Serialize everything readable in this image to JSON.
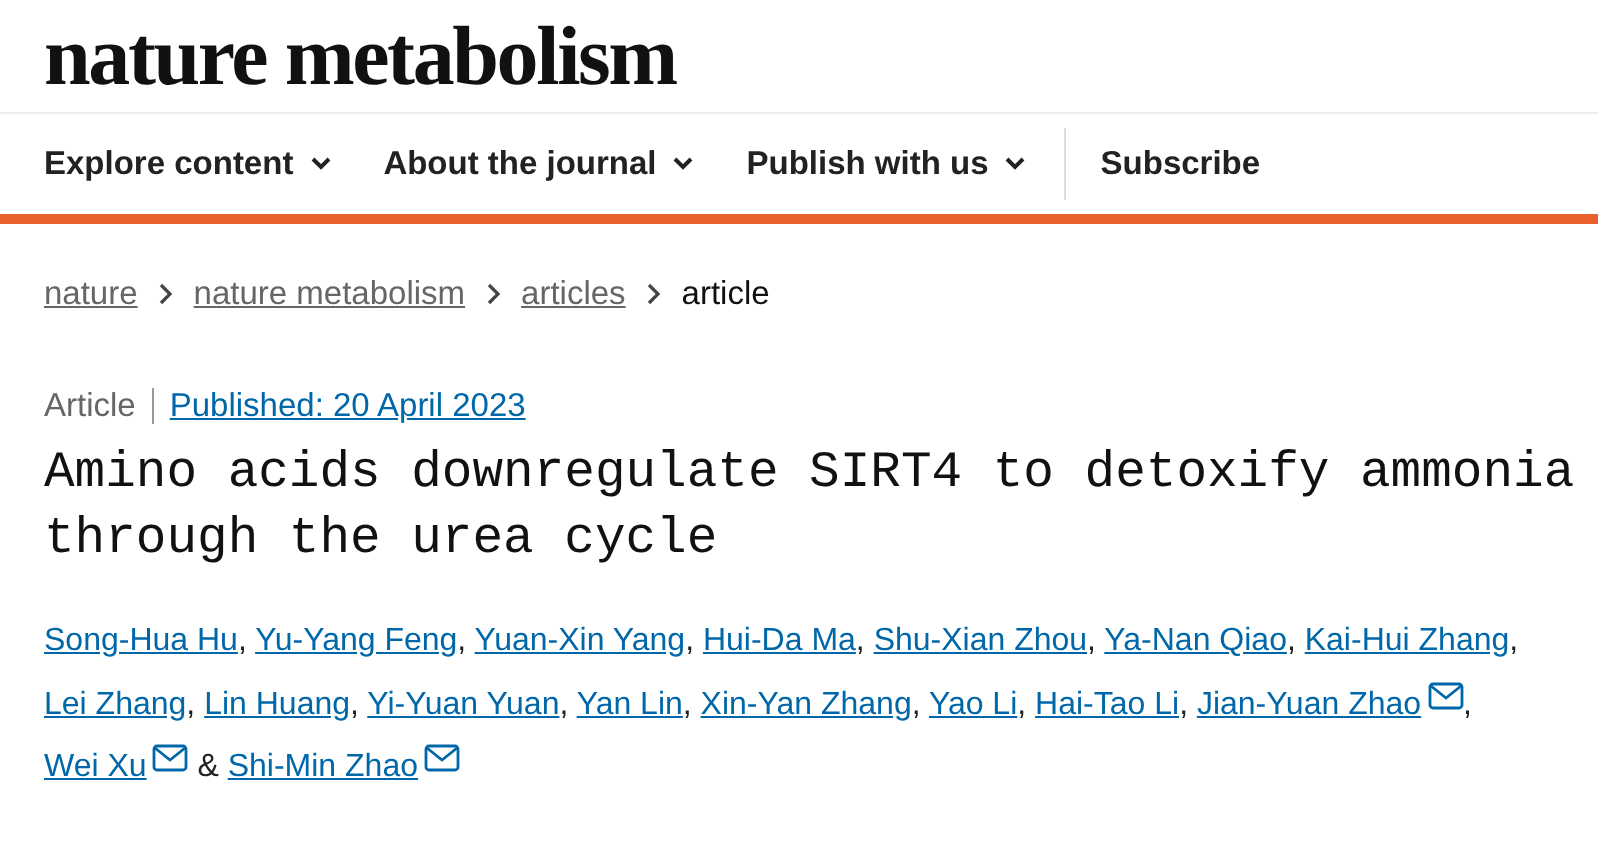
{
  "logo": "nature metabolism",
  "nav": [
    {
      "label": "Explore content",
      "dropdown": true
    },
    {
      "label": "About the journal",
      "dropdown": true
    },
    {
      "label": "Publish with us",
      "dropdown": true
    },
    {
      "label": "Subscribe",
      "dropdown": false
    }
  ],
  "breadcrumb": [
    {
      "label": "nature",
      "current": false
    },
    {
      "label": "nature metabolism",
      "current": false
    },
    {
      "label": "articles",
      "current": false
    },
    {
      "label": "article",
      "current": true
    }
  ],
  "article_type": "Article",
  "published": "Published: 20 April 2023",
  "title": "Amino acids downregulate SIRT4 to detoxify ammonia through the urea cycle",
  "authors": [
    {
      "name": "Song-Hua Hu",
      "email": false,
      "separator": ","
    },
    {
      "name": "Yu-Yang Feng",
      "email": false,
      "separator": ","
    },
    {
      "name": "Yuan-Xin Yang",
      "email": false,
      "separator": ","
    },
    {
      "name": "Hui-Da Ma",
      "email": false,
      "separator": ","
    },
    {
      "name": "Shu-Xian Zhou",
      "email": false,
      "separator": ","
    },
    {
      "name": "Ya-Nan Qiao",
      "email": false,
      "separator": ","
    },
    {
      "name": "Kai-Hui Zhang",
      "email": false,
      "separator": ","
    },
    {
      "name": "Lei Zhang",
      "email": false,
      "separator": ","
    },
    {
      "name": "Lin Huang",
      "email": false,
      "separator": ","
    },
    {
      "name": "Yi-Yuan Yuan",
      "email": false,
      "separator": ","
    },
    {
      "name": "Yan Lin",
      "email": false,
      "separator": ","
    },
    {
      "name": "Xin-Yan Zhang",
      "email": false,
      "separator": ","
    },
    {
      "name": "Yao Li",
      "email": false,
      "separator": ","
    },
    {
      "name": "Hai-Tao Li",
      "email": false,
      "separator": ","
    },
    {
      "name": "Jian-Yuan Zhao",
      "email": true,
      "separator": ","
    },
    {
      "name": "Wei Xu",
      "email": true,
      "separator": "&"
    },
    {
      "name": "Shi-Min Zhao",
      "email": true
    }
  ]
}
